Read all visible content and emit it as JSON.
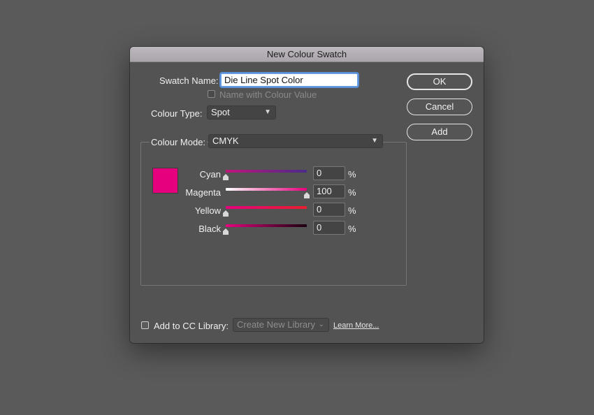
{
  "dialog": {
    "title": "New Colour Swatch",
    "swatch_name_label": "Swatch Name:",
    "swatch_name_value": "Die Line Spot Color",
    "name_with_value_label": "Name with Colour Value",
    "colour_type_label": "Colour Type:",
    "colour_type_value": "Spot",
    "colour_mode_label": "Colour Mode:",
    "colour_mode_value": "CMYK",
    "buttons": {
      "ok": "OK",
      "cancel": "Cancel",
      "add": "Add"
    },
    "preview_color": "#e6007e",
    "sliders": [
      {
        "label": "Cyan",
        "value": "0",
        "unit": "%",
        "fraction": 0.0
      },
      {
        "label": "Magenta",
        "value": "100",
        "unit": "%",
        "fraction": 1.0
      },
      {
        "label": "Yellow",
        "value": "0",
        "unit": "%",
        "fraction": 0.0
      },
      {
        "label": "Black",
        "value": "0",
        "unit": "%",
        "fraction": 0.0
      }
    ],
    "cc_library_label": "Add to CC Library:",
    "cc_library_value": "Create New Library",
    "learn_more": "Learn More..."
  },
  "colors": {
    "background": "#5a5a5a",
    "dialog": "#535353",
    "magenta": "#e6007e"
  }
}
